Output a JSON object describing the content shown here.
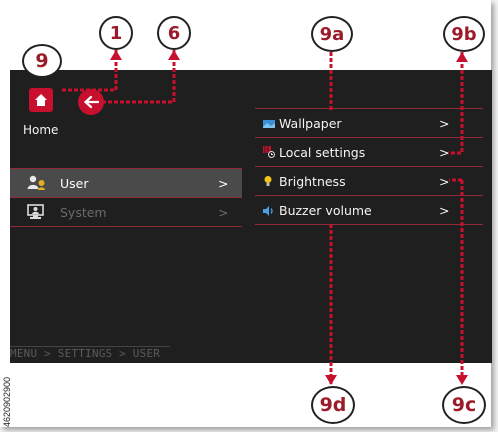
{
  "home": {
    "label": "Home"
  },
  "menu": [
    {
      "label": "User",
      "arrow": ">",
      "active": true
    },
    {
      "label": "System",
      "arrow": ">",
      "active": false
    }
  ],
  "submenu": [
    {
      "label": "Wallpaper",
      "arrow": ">",
      "icon": "wallpaper-icon"
    },
    {
      "label": "Local settings",
      "arrow": ">",
      "icon": "local-settings-icon"
    },
    {
      "label": "Brightness",
      "arrow": ">",
      "icon": "brightness-icon"
    },
    {
      "label": "Buzzer volume",
      "arrow": ">",
      "icon": "speaker-icon"
    }
  ],
  "breadcrumb": "MENU > SETTINGS > USER",
  "callouts": {
    "c9": "9",
    "c1": "1",
    "c6": "6",
    "c9a": "9a",
    "c9b": "9b",
    "c9c": "9c",
    "c9d": "9d"
  },
  "part_number": "4620902900",
  "colors": {
    "accent": "#c8102e",
    "callout_text": "#9b1b2a",
    "screen_bg": "#1f1f1f",
    "divider": "#8e2b35"
  }
}
